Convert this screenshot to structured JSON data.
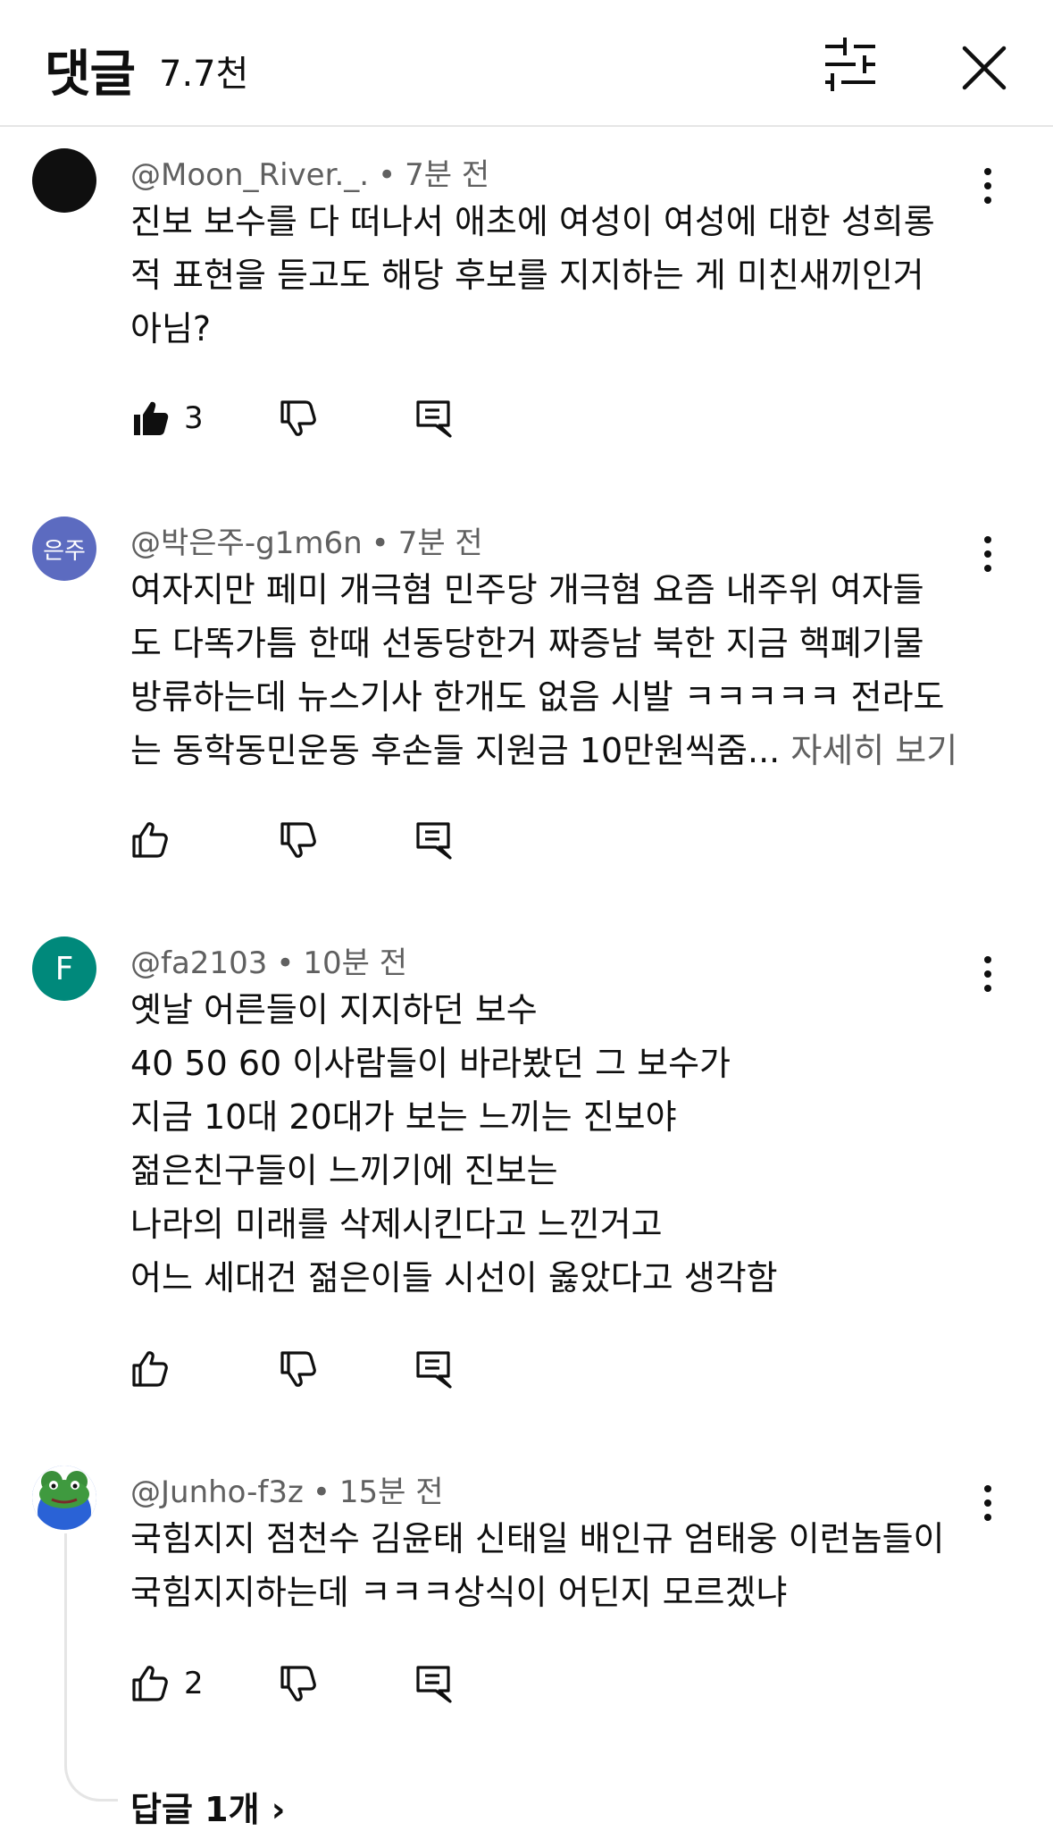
{
  "header": {
    "title": "댓글",
    "count": "7.7천",
    "filter_icon": "sliders-icon",
    "close_icon": "close-icon"
  },
  "comments": [
    {
      "author": "@Moon_River._.",
      "time": "7분 전",
      "avatar_text": "",
      "avatar_color": "#0f0f0f",
      "lines": [
        "진보 보수를 다 떠나서 애초에 여성이 여성에 대한 성희롱",
        "적 표현을 듣고도 해당 후보를 지지하는 게 미친새끼인거",
        "아님?"
      ],
      "likes": "3",
      "liked": true
    },
    {
      "author": "@박은주-g1m6n",
      "time": "7분 전",
      "avatar_text": "은주",
      "avatar_color": "#5c6bc0",
      "lines": [
        "여자지만 페미 개극혐 민주당 개극혐 요즘 내주위 여자들",
        "도 다똑가틈 한때 선동당한거 짜증남 북한 지금 핵폐기물",
        "방류하는데 뉴스기사 한개도 없음 시발 ㅋㅋㅋㅋㅋ 전라도",
        "는 동학동민운동 후손들 지원금 10만원씩줌..."
      ],
      "more": "자세히 보기",
      "likes": "",
      "liked": false
    },
    {
      "author": "@fa2103",
      "time": "10분 전",
      "avatar_text": "F",
      "avatar_color": "#00897b",
      "lines": [
        "옛날 어른들이 지지하던 보수",
        "40 50 60 이사람들이 바라봤던 그 보수가",
        "지금 10대 20대가 보는 느끼는 진보야",
        "젊은친구들이 느끼기에 진보는",
        "나라의 미래를 삭제시킨다고 느낀거고",
        "어느 세대건 젊은이들 시선이 옳았다고 생각함"
      ],
      "likes": "",
      "liked": false
    },
    {
      "author": "@Junho-f3z",
      "time": "15분 전",
      "avatar_text": "",
      "avatar_color": "#2e7d32",
      "lines": [
        "국힘지지 점천수 김윤태 신태일 배인규 엄태웅 이런놈들이",
        "국힘지지하는데 ㅋㅋㅋ상식이 어딘지 모르겠냐"
      ],
      "likes": "2",
      "liked": false
    }
  ],
  "replies_toggle": "답글 1개"
}
